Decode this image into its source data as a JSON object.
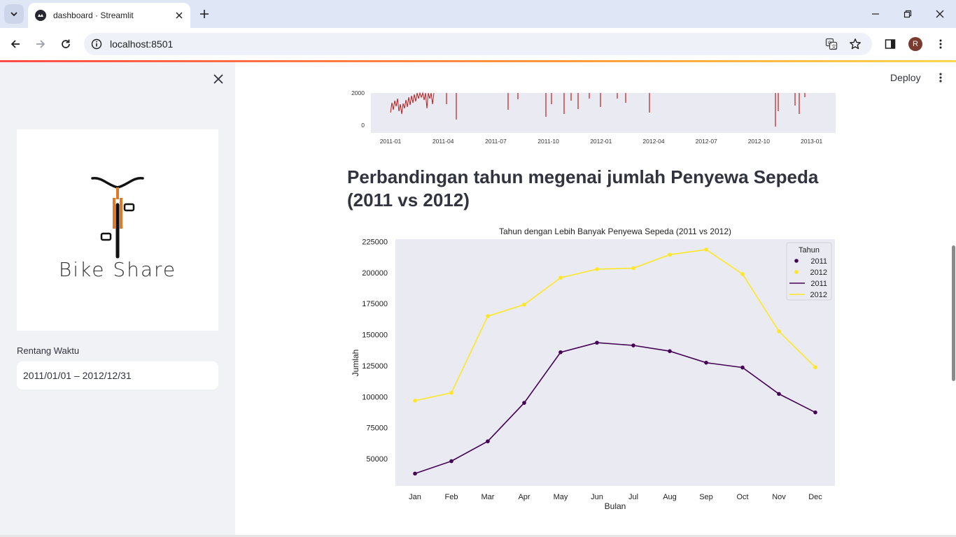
{
  "browser": {
    "tab_title": "dashboard · Streamlit",
    "url": "localhost:8501",
    "profile_initial": "R",
    "icons": {
      "tab_search": "chevron-down-icon",
      "favicon": "streamlit-favicon",
      "tab_close": "close-icon",
      "new_tab": "plus-icon",
      "minimize": "minimize-icon",
      "restore": "restore-icon",
      "close_window": "close-icon",
      "back": "arrow-left-icon",
      "forward": "arrow-right-icon",
      "reload": "reload-icon",
      "site_info": "info-icon",
      "translate": "translate-icon",
      "bookmark": "star-icon",
      "side_panel": "side-panel-icon",
      "menu": "kebab-menu-icon"
    }
  },
  "sidebar": {
    "logo_text": "Bike Share",
    "date_label": "Rentang Waktu",
    "date_value": "2011/01/01 – 2012/12/31"
  },
  "header": {
    "deploy_label": "Deploy"
  },
  "main": {
    "section_title": "Perbandingan tahun megenai jumlah Penyewa Sepeda (2011 vs 2012)"
  },
  "colors": {
    "series_2011": "#440154",
    "series_2012": "#fde725",
    "daily_line": "#b22222",
    "plot_bg": "#eaeaf2",
    "accent": "#ff4b4b"
  },
  "chart_data": [
    {
      "type": "line",
      "partial": true,
      "x_ticks": [
        "2011-01",
        "2011-04",
        "2011-07",
        "2011-10",
        "2012-01",
        "2012-04",
        "2012-07",
        "2012-10",
        "2013-01"
      ],
      "y_ticks": [
        "2000",
        "0"
      ],
      "grid": false
    },
    {
      "type": "line",
      "title": "Tahun dengan Lebih Banyak Penyewa Sepeda (2011 vs 2012)",
      "xlabel": "Bulan",
      "ylabel": "Jumlah",
      "categories": [
        "Jan",
        "Feb",
        "Mar",
        "Apr",
        "May",
        "Jun",
        "Jul",
        "Aug",
        "Sep",
        "Oct",
        "Nov",
        "Dec"
      ],
      "series": [
        {
          "name": "2011",
          "values": [
            38000,
            48000,
            64000,
            95000,
            135800,
            143500,
            141300,
            136700,
            127400,
            123500,
            102200,
            87300
          ]
        },
        {
          "name": "2012",
          "values": [
            96800,
            103100,
            164900,
            174200,
            195900,
            202800,
            203600,
            214500,
            218600,
            198800,
            152700,
            123700
          ]
        }
      ],
      "y_ticks": [
        50000,
        75000,
        100000,
        125000,
        150000,
        175000,
        200000,
        225000
      ],
      "ylim": [
        28000,
        227000
      ],
      "legend": {
        "title": "Tahun",
        "placement": "top-right",
        "entries": [
          {
            "label": "2011",
            "kind": "marker",
            "series": 0
          },
          {
            "label": "2012",
            "kind": "marker",
            "series": 1
          },
          {
            "label": "2011",
            "kind": "line",
            "series": 0
          },
          {
            "label": "2012",
            "kind": "line",
            "series": 1
          }
        ]
      },
      "grid": false
    }
  ]
}
